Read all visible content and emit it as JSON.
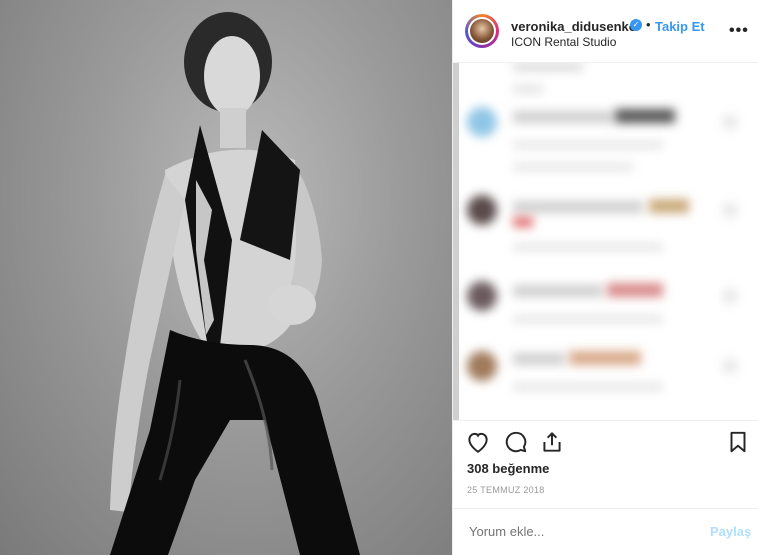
{
  "post": {
    "username": "veronika_didusenko",
    "separator": "•",
    "follow_label": "Takip Et",
    "location": "ICON Rental Studio",
    "more_label": "•••",
    "verified_glyph": "✓",
    "likes": "308 beğenme",
    "date": "25 TEMMUZ 2018"
  },
  "comment_box": {
    "placeholder": "Yorum ekle...",
    "share_label": "Paylaş"
  },
  "icons": {
    "like": "heart-icon",
    "comment": "comment-icon",
    "share": "share-icon",
    "save": "bookmark-icon",
    "verified": "verified-badge-icon",
    "more": "more-options-icon"
  },
  "colors": {
    "accent": "#3897f0",
    "share_disabled": "#b2dffc",
    "text": "#262626",
    "muted": "#999999"
  }
}
